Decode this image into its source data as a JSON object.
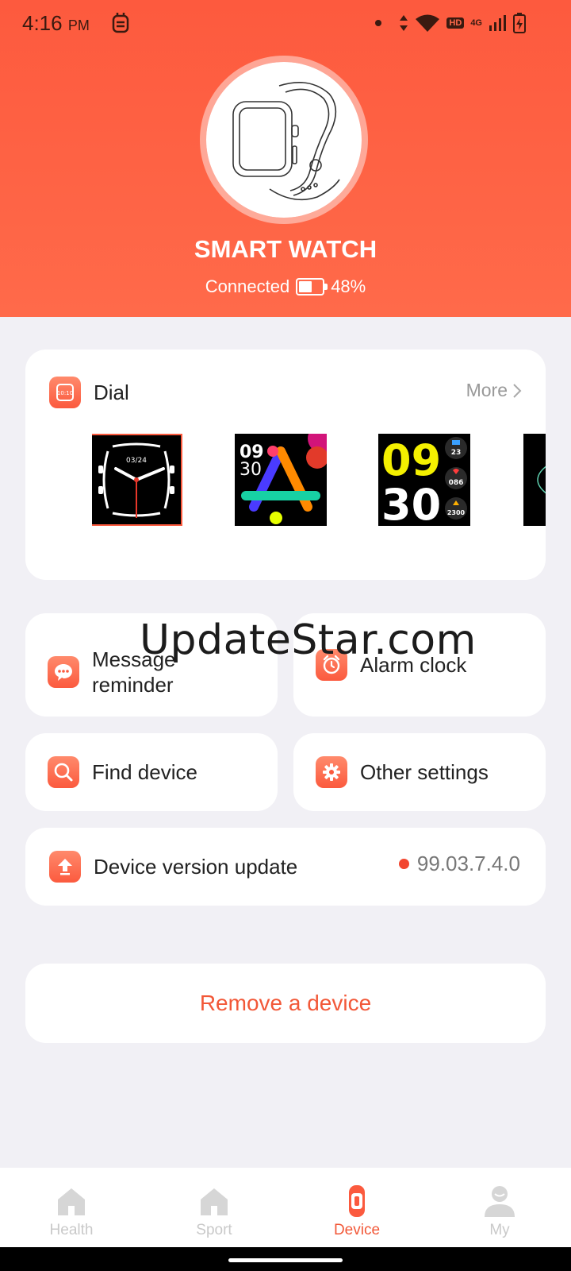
{
  "status_bar": {
    "time": "4:16",
    "ampm": "PM",
    "hd": "HD",
    "network": "4G"
  },
  "device": {
    "name": "SMART WATCH",
    "status": "Connected",
    "battery_percent_label": "48%",
    "battery_level": 0.48
  },
  "dial": {
    "title": "Dial",
    "more_label": "More",
    "faces": [
      {
        "id": "face-1",
        "date": "03/24",
        "selected": true
      },
      {
        "id": "face-2",
        "time_top": "09",
        "time_bottom": "30"
      },
      {
        "id": "face-3",
        "time_top": "09",
        "time_bottom": "30",
        "stat_1": "23",
        "stat_2": "086",
        "stat_3": "2300"
      }
    ]
  },
  "menu": {
    "message_reminder": "Message\nreminder",
    "alarm_clock": "Alarm clock",
    "find_device": "Find device",
    "other_settings": "Other settings"
  },
  "version": {
    "label": "Device version update",
    "value": "99.03.7.4.0"
  },
  "remove_label": "Remove a device",
  "watermark": "UpdateStar.com",
  "tabs": [
    {
      "label": "Health",
      "active": false
    },
    {
      "label": "Sport",
      "active": false
    },
    {
      "label": "Device",
      "active": true
    },
    {
      "label": "My",
      "active": false
    }
  ],
  "colors": {
    "accent": "#fb5a3e",
    "header": "#ff6a4a",
    "background": "#f1f0f5"
  }
}
